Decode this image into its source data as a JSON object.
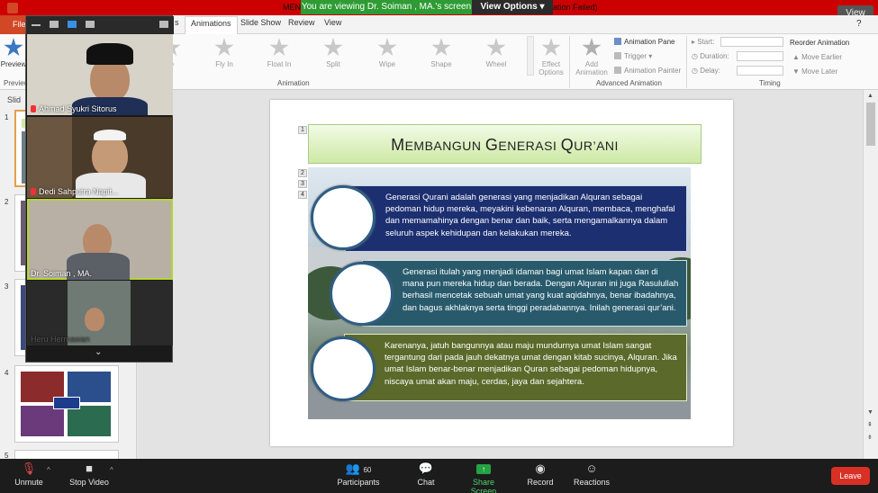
{
  "zoom": {
    "share_banner": "You are viewing Dr. Soiman , MA.'s screen",
    "view_options": "View Options",
    "view_button": "View",
    "window_title_left": "MEN",
    "window_title_right": "ation Failed)"
  },
  "ppt": {
    "file_tab": "File",
    "tabs": [
      "s",
      "Animations",
      "Slide Show",
      "Review",
      "View"
    ],
    "preview_label": "Preview",
    "preview_group": "Preview",
    "animation_group": "Animation",
    "advanced_group": "Advanced Animation",
    "timing_group": "Timing",
    "animations": [
      "le",
      "Fly In",
      "Float In",
      "Split",
      "Wipe",
      "Shape",
      "Wheel"
    ],
    "effect_options": "Effect Options",
    "add_animation": "Add Animation",
    "animation_pane": "Animation Pane",
    "trigger": "Trigger",
    "animation_painter": "Animation Painter",
    "start_label": "Start:",
    "duration_label": "Duration:",
    "delay_label": "Delay:",
    "reorder_label": "Reorder Animation",
    "move_earlier": "Move Earlier",
    "move_later": "Move Later",
    "slides_label": "Slid"
  },
  "thumbnails": [
    {
      "num": "1"
    },
    {
      "num": "2"
    },
    {
      "num": "3"
    },
    {
      "num": "4"
    },
    {
      "num": "5"
    }
  ],
  "slide": {
    "title_big1": "M",
    "title_small1": "EMBANGUN ",
    "title_big2": "G",
    "title_small2": "ENERASI ",
    "title_big3": "Q",
    "title_small3": "UR’ANI",
    "tags": [
      "1",
      "2",
      "3",
      "4"
    ],
    "paragraphs": [
      "Generasi Qurani adalah generasi yang menjadikan Alquran sebagai pedoman hidup mereka, meyakini kebenaran Alquran, membaca, menghafal dan memamahinya dengan benar dan baik, serta mengamalkannya dalam seluruh aspek kehidupan dan kelakukan mereka.",
      "Generasi itulah yang menjadi idaman bagi umat Islam kapan dan di mana pun mereka hidup dan berada. Dengan Alquran ini juga Rasulullah berhasil mencetak sebuah umat yang kuat aqidahnya, benar ibadahnya, dan bagus akhlaknya serta tinggi peradabannya. Inilah generasi qur’ani.",
      "Karenanya, jatuh bangunnya atau maju mundurnya umat Islam sangat tergantung dari pada jauh dekatnya umat dengan kitab sucinya, Alquran. Jika umat Islam benar-benar menjadikan Quran sebagai pedoman hidupnya, niscaya umat akan maju, cerdas, jaya dan sejahtera."
    ]
  },
  "participants": [
    {
      "name": "Ahmad Syukri Sitorus",
      "muted": true
    },
    {
      "name": "Dedi Sahputra Napit...",
      "muted": true
    },
    {
      "name": "Dr. Soiman , MA.",
      "muted": false,
      "active": true
    },
    {
      "name": "Heru Hermawan",
      "muted": false
    }
  ],
  "toolbar": {
    "unmute": "Unmute",
    "stop_video": "Stop Video",
    "participants": "Participants",
    "participants_count": "60",
    "chat": "Chat",
    "share_screen": "Share Screen",
    "record": "Record",
    "reactions": "Reactions",
    "leave": "Leave"
  },
  "colors": {
    "zoom_banner_red": "#cc0000",
    "share_green": "#2e9b34",
    "active_speaker": "#b5d430",
    "leave_red": "#d93025",
    "box1": "#1c2f70",
    "box2": "#285a6c",
    "box3": "#5b6a2a"
  }
}
